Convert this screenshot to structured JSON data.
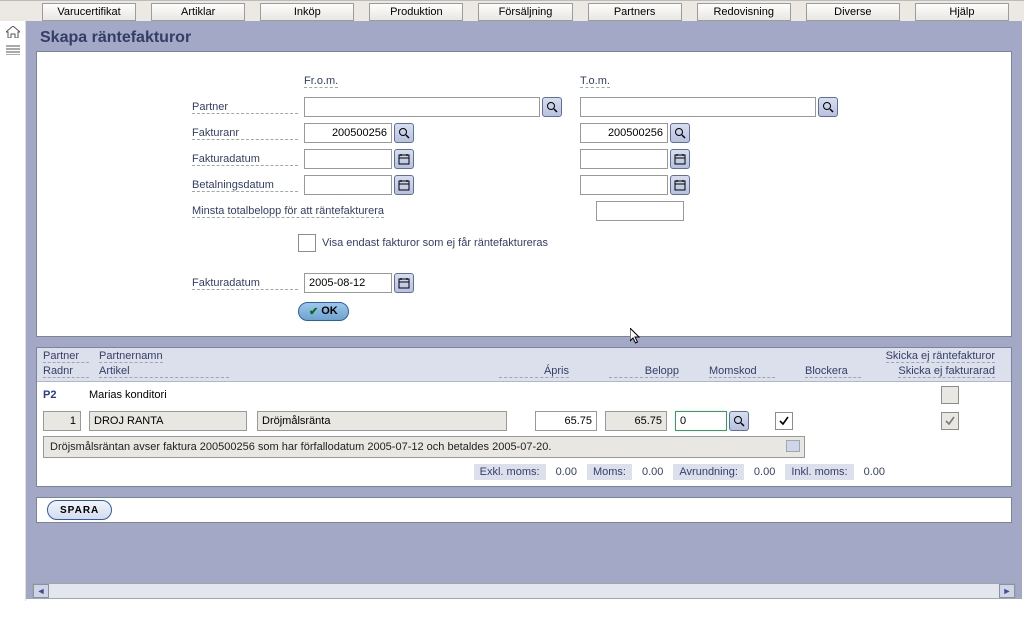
{
  "menu": [
    "Varucertifikat",
    "Artiklar",
    "Inköp",
    "Produktion",
    "Försäljning",
    "Partners",
    "Redovisning",
    "Diverse",
    "Hjälp"
  ],
  "title": "Skapa räntefakturor",
  "form": {
    "from_label": "Fr.o.m.",
    "to_label": "T.o.m.",
    "partner_label": "Partner",
    "partner_from": "",
    "partner_to": "",
    "fakturanr_label": "Fakturanr",
    "fakturanr_from": "200500256",
    "fakturanr_to": "200500256",
    "fakturadatum_label": "Fakturadatum",
    "fakturadatum_from": "",
    "fakturadatum_to": "",
    "betalningsdatum_label": "Betalningsdatum",
    "betalningsdatum_from": "",
    "betalningsdatum_to": "",
    "minsta_label": "Minsta totalbelopp för att räntefakturera",
    "minsta_value": "",
    "visa_label": "Visa endast fakturor som ej får räntefaktureras",
    "visa_checked": false,
    "fakturadatum2_label": "Fakturadatum",
    "fakturadatum2_value": "2005-08-12",
    "ok_label": "OK"
  },
  "table": {
    "head1": {
      "partner": "Partner",
      "partnernamn": "Partnernamn",
      "skicka_rf": "Skicka ej räntefakturor"
    },
    "head2": {
      "radnr": "Radnr",
      "artikel": "Artikel",
      "apris": "Ápris",
      "belopp": "Belopp",
      "momskod": "Momskod",
      "blockera": "Blockera",
      "skicka_rad": "Skicka ej fakturarad"
    },
    "partner_row": {
      "id": "P2",
      "name": "Marias konditori",
      "skicka_rf": false
    },
    "line": {
      "radnr": "1",
      "artikel_kod": "DROJ RANTA",
      "artikel_namn": "Dröjmålsränta",
      "apris": "65.75",
      "belopp": "65.75",
      "momskod": "0",
      "blockera": true,
      "skicka_rad": true
    },
    "note": "Dröjsmålsräntan avser faktura 200500256 som har förfallodatum 2005-07-12  och betaldes 2005-07-20.",
    "totals": {
      "exkl_label": "Exkl. moms:",
      "exkl": "0.00",
      "moms_label": "Moms:",
      "moms": "0.00",
      "avr_label": "Avrundning:",
      "avr": "0.00",
      "inkl_label": "Inkl. moms:",
      "inkl": "0.00"
    }
  },
  "save_label": "SPARA"
}
